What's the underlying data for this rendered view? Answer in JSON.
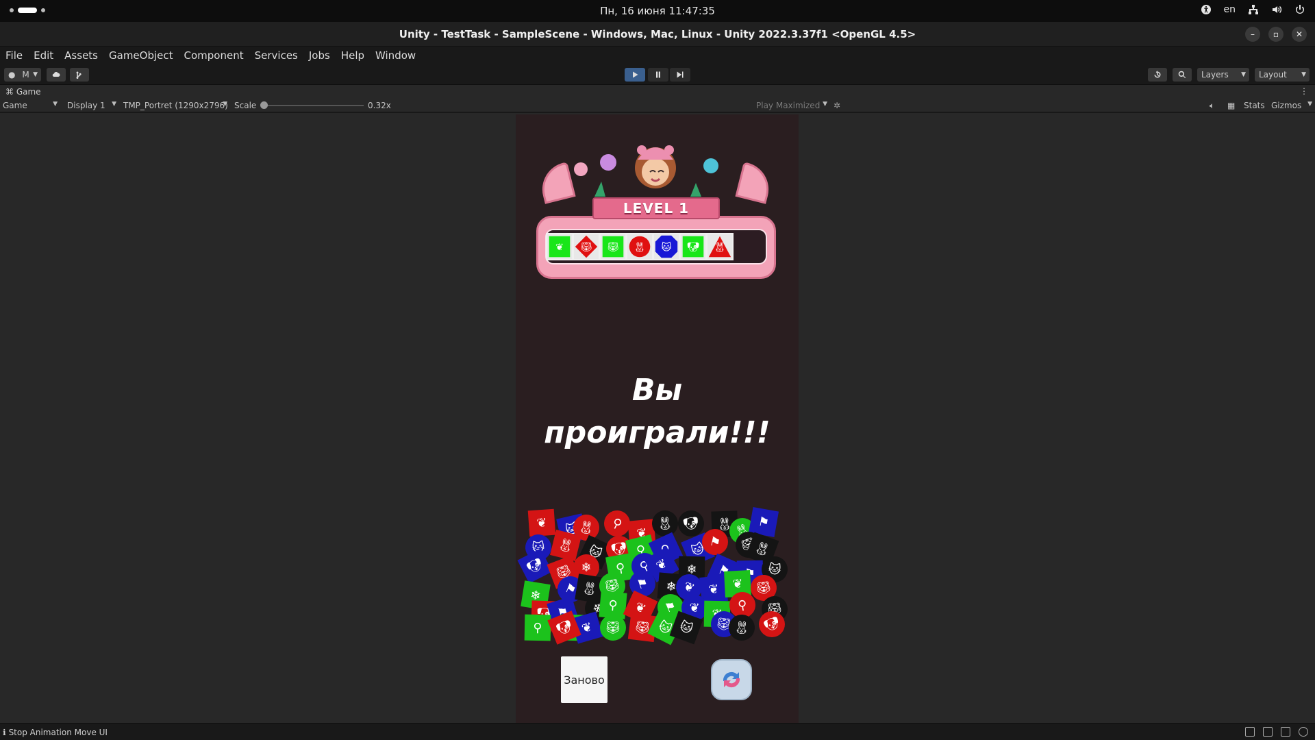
{
  "topbar": {
    "clock": "Пн, 16 июня  11:47:35",
    "lang": "en"
  },
  "window": {
    "title": "Unity - TestTask - SampleScene - Windows, Mac, Linux - Unity 2022.3.37f1 <OpenGL 4.5>"
  },
  "menu": [
    "File",
    "Edit",
    "Assets",
    "GameObject",
    "Component",
    "Services",
    "Jobs",
    "Help",
    "Window"
  ],
  "toolbar": {
    "account_label": "M",
    "layers_label": "Layers",
    "layout_label": "Layout"
  },
  "game_tab": {
    "label": "Game"
  },
  "game_bar": {
    "mode": "Game",
    "display": "Display 1",
    "resolution": "TMP_Portret (1290x2796)",
    "scale_label": "Scale",
    "scale_value": "0.32x",
    "play_mode": "Play Maximized",
    "stats": "Stats",
    "gizmos": "Gizmos"
  },
  "game": {
    "level_label": "LEVEL 1",
    "result_line1": "Вы",
    "result_line2": "проиграли!!!",
    "restart_button": "Заново",
    "slots": [
      {
        "shape": "square",
        "color": "#19e619",
        "icon": "leaf-icon"
      },
      {
        "shape": "diamond",
        "color": "#e01010",
        "icon": "tiger-icon"
      },
      {
        "shape": "square",
        "color": "#19e619",
        "icon": "tiger-icon"
      },
      {
        "shape": "circle",
        "color": "#e01010",
        "icon": "rabbit-icon"
      },
      {
        "shape": "octagon",
        "color": "#1818d6",
        "icon": "cat-icon"
      },
      {
        "shape": "square",
        "color": "#19e619",
        "icon": "dog-icon"
      },
      {
        "shape": "triangle",
        "color": "#e01010",
        "icon": "rabbit-icon"
      }
    ]
  },
  "status": {
    "message": "Stop Animation Move UI"
  },
  "colors": {
    "game_bg": "#2a1e20",
    "panel_pink": "#f3a3b8",
    "banner_pink": "#e46a8c",
    "tile_red": "#d41414",
    "tile_blue": "#1a1ab8",
    "tile_green": "#1cc21c",
    "tile_black": "#141414",
    "play_active": "#3a5f8e"
  }
}
